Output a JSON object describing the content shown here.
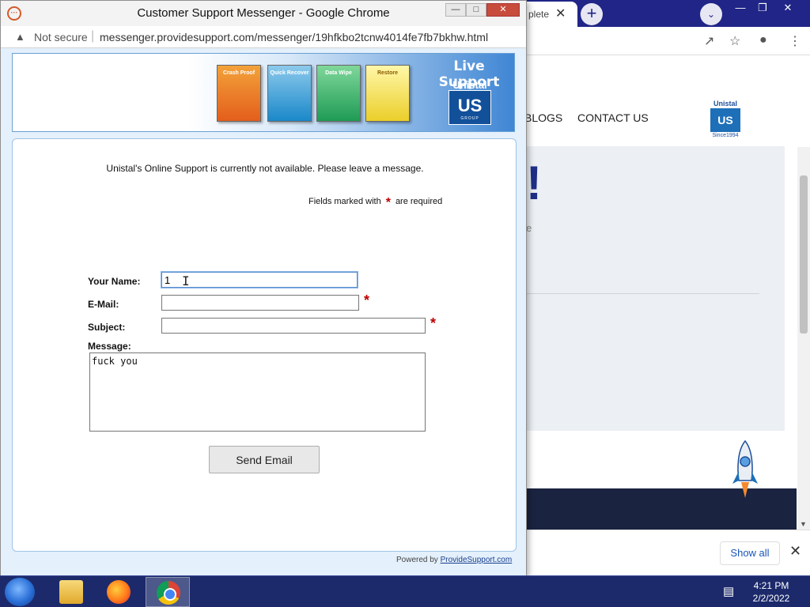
{
  "background_browser": {
    "tab_title": "plete",
    "nav": [
      "BLOGS",
      "CONTACT US"
    ],
    "logo": {
      "name": "Unistal",
      "mark": "US",
      "since": "Since1994"
    },
    "hero_exclaim": "!",
    "hero_text": "e",
    "download_bar": {
      "show_all": "Show all",
      "close": "✕"
    }
  },
  "popup": {
    "window_title": "Customer Support Messenger - Google Chrome",
    "security_label": "Not secure",
    "url": "messenger.providesupport.com/messenger/19hfkbo2tcnw4014fe7fb7bkhw.html",
    "banner": {
      "live_support": "Live Support",
      "brand": "Unistal",
      "brand_mark": "US",
      "group": "GROUP",
      "products": [
        "Crash Proof",
        "Quick Recover",
        "Data Wipe",
        "Restore"
      ]
    },
    "form": {
      "notice": "Unistal's Online Support is currently not available. Please leave a message.",
      "required_prefix": "Fields marked with",
      "required_star": "*",
      "required_suffix": "are required",
      "name_label": "Your Name:",
      "name_value": "1",
      "email_label": "E-Mail:",
      "email_value": "",
      "subject_label": "Subject:",
      "subject_value": "",
      "message_label": "Message:",
      "message_value": "fuck you",
      "send_label": "Send Email",
      "powered_prefix": "Powered by",
      "powered_link": "ProvideSupport.com"
    }
  },
  "taskbar": {
    "time": "4:21 PM",
    "date": "2/2/2022"
  }
}
